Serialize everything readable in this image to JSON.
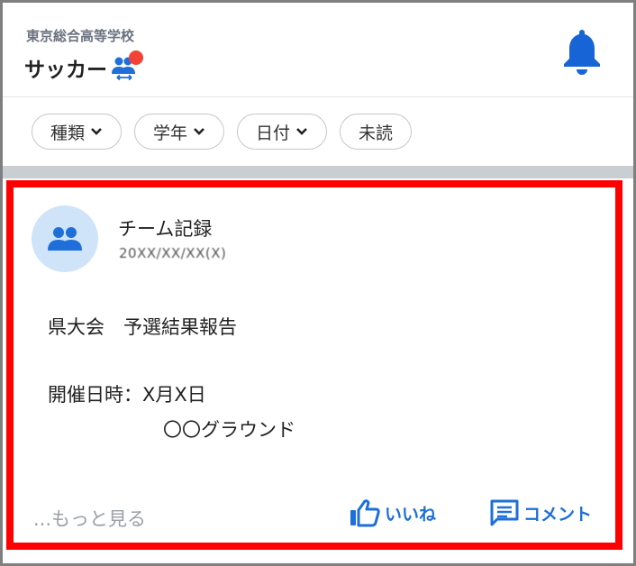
{
  "header": {
    "school_name": "東京総合高等学校",
    "team_name": "サッカー"
  },
  "filters": [
    {
      "label": "種類",
      "has_dropdown": true
    },
    {
      "label": "学年",
      "has_dropdown": true
    },
    {
      "label": "日付",
      "has_dropdown": true
    },
    {
      "label": "未読",
      "has_dropdown": false
    }
  ],
  "post": {
    "author": "チーム記録",
    "date": "20XX/XX/XX(X)",
    "title": "県大会　予選結果報告",
    "detail_label": "開催日時：X月X日",
    "location": "〇〇グラウンド",
    "more_label": "...もっと見る",
    "like_label": "いいね",
    "comment_label": "コメント"
  },
  "colors": {
    "accent": "#1e6fd9",
    "highlight_border": "#ff0000",
    "notification_dot": "#f44336",
    "avatar_bg": "#cfe3f9"
  }
}
